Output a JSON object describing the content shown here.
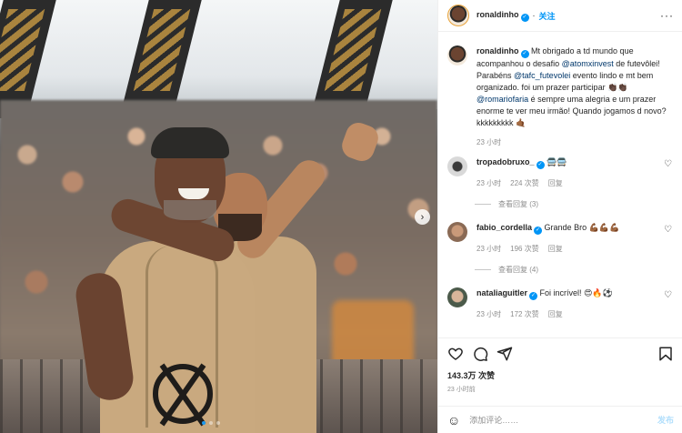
{
  "post": {
    "username": "ronaldinho",
    "follow_sep": "·",
    "follow_label": "关注",
    "more_label": "···",
    "caption": {
      "username": "ronaldinho",
      "part1": " Mt obrigado a td mundo que acompanhou o desafio ",
      "mention1": "@atomxinvest",
      "part2": " de futevôlei! Parabéns ",
      "mention2": "@tafc_futevolei",
      "part3": " evento lindo e mt bem organizado. foi um prazer participar 👏🏿👏🏿 ",
      "mention3": "@romariofaria",
      "part4": " é sempre uma alegria e um prazer enorme te ver meu irmão! Quando jogamos d novo? kkkkkkkkk 🤙🏾",
      "time": "23 小时"
    },
    "comments": [
      {
        "username": "tropadobruxo_",
        "text": "🚍🚍",
        "time": "23 小时",
        "likes": "224 次赞",
        "reply": "回复",
        "view_replies": "查看回复 (3)"
      },
      {
        "username": "fabio_cordella",
        "text": "Grande Bro 💪🏾💪🏾💪🏾",
        "time": "23 小时",
        "likes": "196 次赞",
        "reply": "回复",
        "view_replies": "查看回复 (4)"
      },
      {
        "username": "nataliaguitler",
        "text": "Foi incrível! 😍🔥⚽",
        "time": "23 小时",
        "likes": "172 次赞",
        "reply": "回复"
      }
    ],
    "likes_count": "143.3万 次赞",
    "posted_ago": "23 小时前",
    "add_comment": {
      "placeholder": "添加评论……",
      "post_label": "发布",
      "emoji_icon": "smile-icon"
    },
    "carousel_next_icon": "chevron-right-icon"
  },
  "colors": {
    "accent": "#0095f6",
    "link": "#00376b",
    "muted": "#8e8e8e"
  }
}
